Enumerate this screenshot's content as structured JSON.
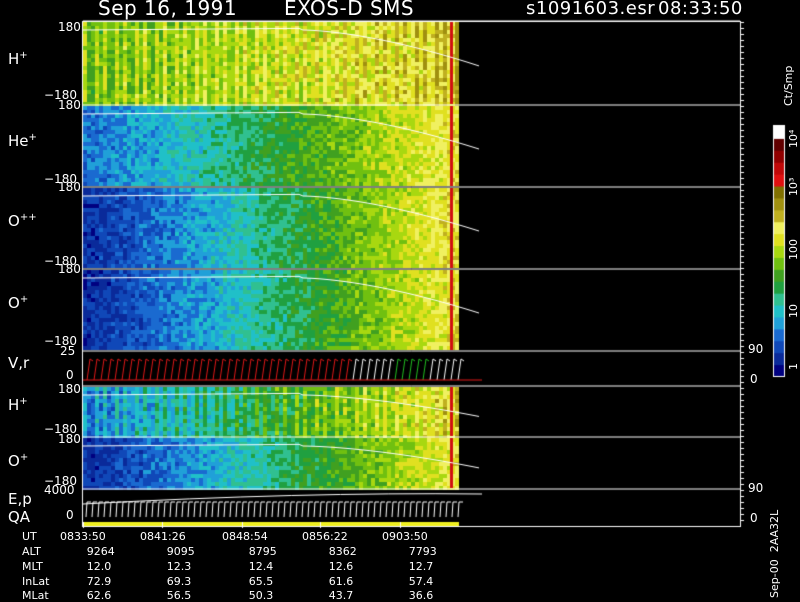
{
  "header": {
    "date": "Sep 16, 1991",
    "instrument": "EXOS-D SMS",
    "file": "s1091603.esr",
    "time": "08:33:50"
  },
  "colorbar": {
    "unit_label": "Ct/Smp",
    "ticks": [
      "1",
      "10",
      "100",
      "10³",
      "10⁴"
    ],
    "colors": [
      "#000080",
      "#0a2a9a",
      "#1048b8",
      "#1a6ad0",
      "#20a0d8",
      "#20c0c8",
      "#30c090",
      "#20a040",
      "#40a020",
      "#70c010",
      "#a8d810",
      "#e0e020",
      "#f0f060",
      "#c0b020",
      "#a09010",
      "#807000",
      "#e01010",
      "#c00808",
      "#900000",
      "#600000",
      "#ffffff"
    ]
  },
  "panels": [
    {
      "id": "h_plus",
      "species": "H",
      "charge": "+",
      "ymax": "180",
      "ymin": "−180"
    },
    {
      "id": "he_plus",
      "species": "He",
      "charge": "+",
      "ymax": "180",
      "ymin": "−180"
    },
    {
      "id": "o_plusplus",
      "species": "O",
      "charge": "++",
      "ymax": "180",
      "ymin": "−180"
    },
    {
      "id": "o_plus",
      "species": "O",
      "charge": "+",
      "ymax": "180",
      "ymin": "−180"
    },
    {
      "id": "vr",
      "label": "V,r",
      "ymax": "25",
      "ymin": "0",
      "rmax": "90",
      "rmin": "0"
    },
    {
      "id": "h_plus_2",
      "species": "H",
      "charge": "+",
      "ymax": "180",
      "ymin": "−180"
    },
    {
      "id": "o_plus_2",
      "species": "O",
      "charge": "+",
      "ymax": "180",
      "ymin": "−180"
    },
    {
      "id": "ep_qa",
      "label1": "E,p",
      "label2": "QA",
      "ymax": "4000",
      "ymin": "0",
      "rmax": "90",
      "rmin": "0"
    }
  ],
  "ephemeris": {
    "row_labels": [
      "UT",
      "ALT",
      "MLT",
      "InLat",
      "MLat"
    ],
    "columns": [
      [
        "0833:50",
        "9264",
        "12.0",
        "72.9",
        "62.6"
      ],
      [
        "0841:26",
        "9095",
        "12.3",
        "69.3",
        "56.5"
      ],
      [
        "0848:54",
        "8795",
        "12.4",
        "65.5",
        "50.3"
      ],
      [
        "0856:22",
        "8362",
        "12.6",
        "61.6",
        "43.7"
      ],
      [
        "0903:50",
        "7793",
        "12.7",
        "57.4",
        "36.6"
      ]
    ]
  },
  "footer_stamp": "Sep-00  2AA32L",
  "chart_data": {
    "type": "heatmap",
    "title": "Sep 16, 1991   EXOS-D SMS   s1091603.esr  08:33:50",
    "x_ticks": [
      "0833:50",
      "0841:26",
      "0848:54",
      "0856:22",
      "0903:50"
    ],
    "colorbar": {
      "label": "Ct/Smp",
      "scale": "log",
      "range": [
        1,
        10000
      ]
    },
    "series": [
      {
        "name": "H+",
        "y_range": [
          -180,
          180
        ],
        "trend": "green-dominant, increasing to yellow toward 0903"
      },
      {
        "name": "He+",
        "y_range": [
          -180,
          180
        ],
        "trend": "blue early, rising to green/yellow near 0900"
      },
      {
        "name": "O++",
        "y_range": [
          -180,
          180
        ],
        "trend": "dark blue early, yellow near 0900"
      },
      {
        "name": "O+",
        "y_range": [
          -180,
          180
        ],
        "trend": "dark blue early, yellow near 0900"
      },
      {
        "name": "V,r",
        "y_range": [
          0,
          25
        ],
        "r_range": [
          0,
          90
        ]
      },
      {
        "name": "H+ (2)",
        "y_range": [
          -180,
          180
        ],
        "trend": "blue to yellow"
      },
      {
        "name": "O+ (2)",
        "y_range": [
          -180,
          180
        ],
        "trend": "blue to yellow"
      },
      {
        "name": "E,p / QA",
        "y_range": [
          0,
          4000
        ],
        "r_range": [
          0,
          90
        ]
      }
    ]
  }
}
